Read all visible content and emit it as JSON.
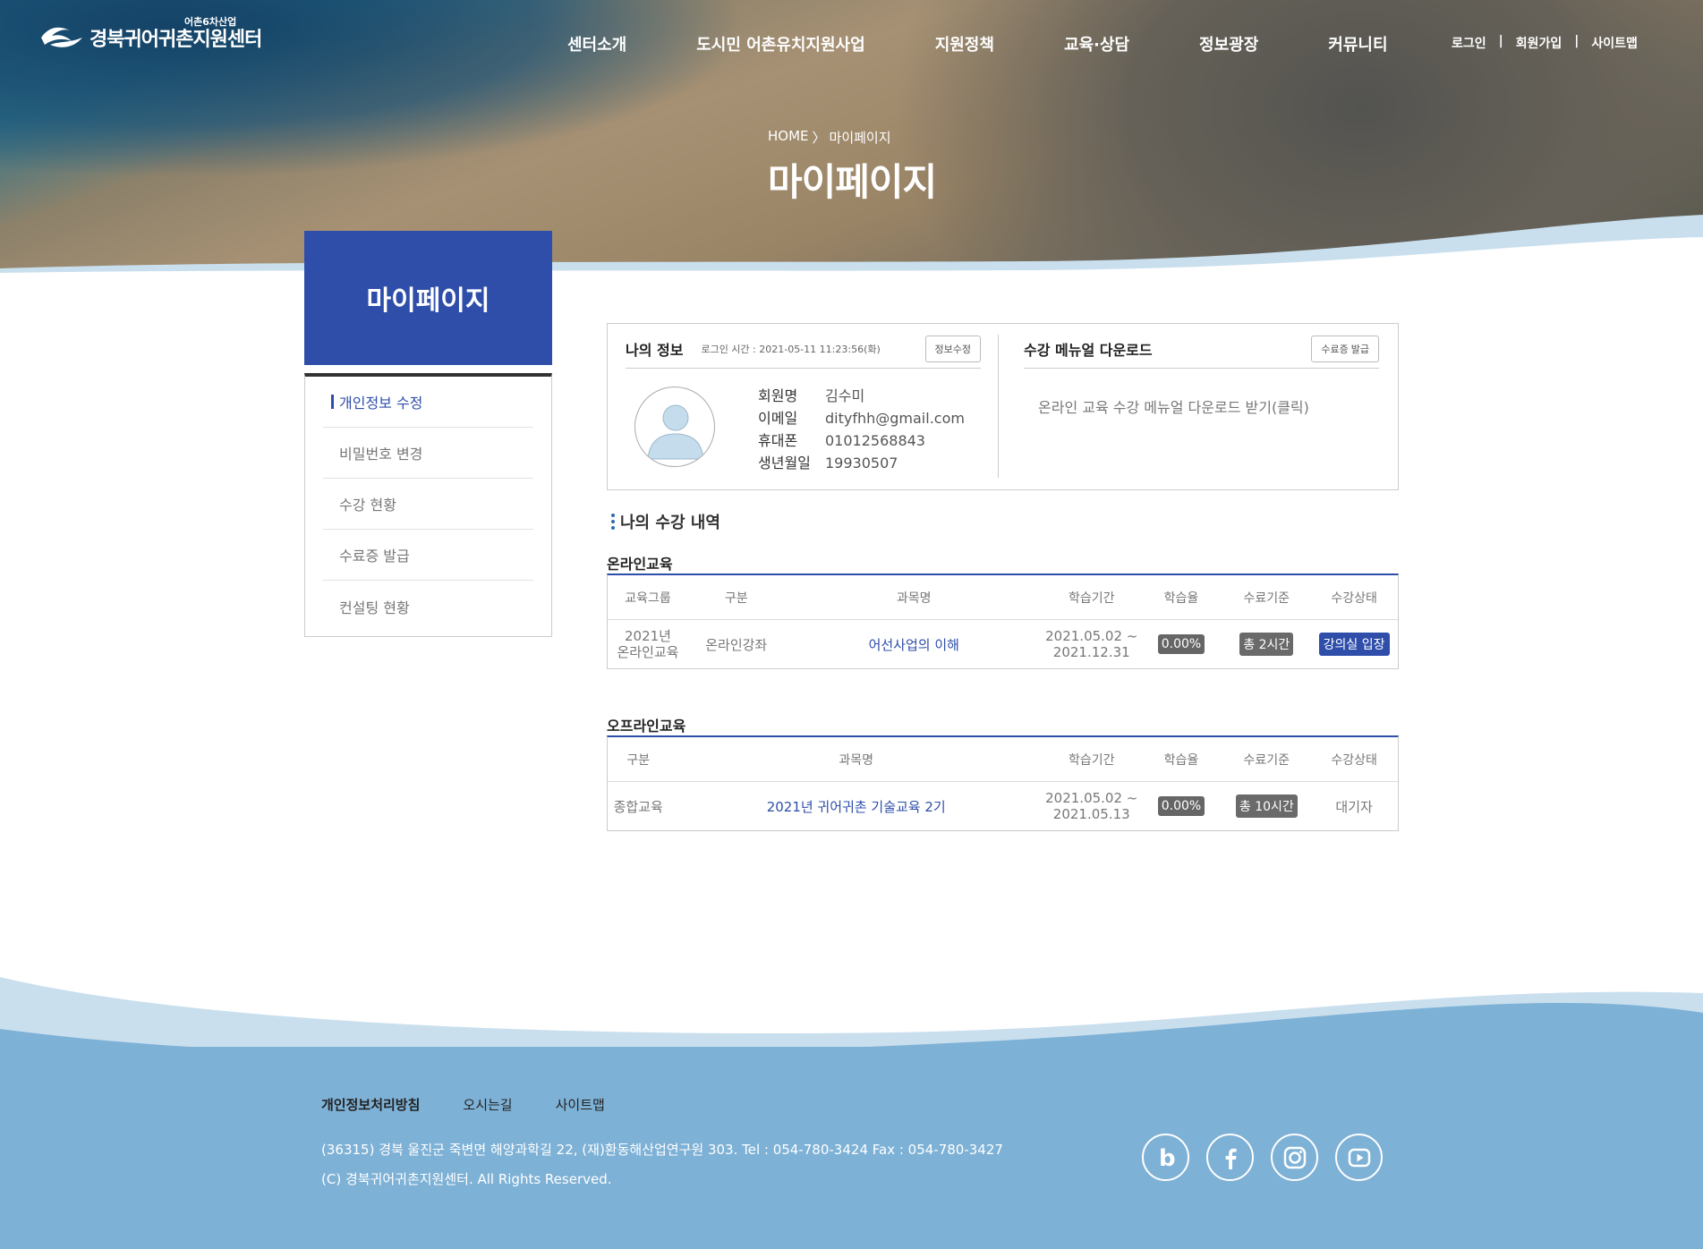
{
  "header": {
    "logo_text": "경북귀어귀촌지원센터",
    "logo_sub": "어촌6차산업",
    "nav": [
      "센터소개",
      "도시민 어촌유치지원사업",
      "지원정책",
      "교육·상담",
      "정보광장",
      "커뮤니티"
    ],
    "util": {
      "login": "로그인",
      "join": "회원가입",
      "sitemap": "사이트맵",
      "sep": "|"
    }
  },
  "hero": {
    "breadcrumb_home": "HOME",
    "breadcrumb_sep": "〉",
    "breadcrumb_current": "마이페이지",
    "title": "마이페이지"
  },
  "sidebar": {
    "title": "마이페이지",
    "items": [
      {
        "label": "개인정보 수정"
      },
      {
        "label": "비밀번호 변경"
      },
      {
        "label": "수강 현황"
      },
      {
        "label": "수료증 발급"
      },
      {
        "label": "컨설팅 현황"
      }
    ]
  },
  "my_info": {
    "title": "나의 정보",
    "login_time": "로그인 시간 : 2021-05-11 11:23:56(화)",
    "edit_button": "정보수정",
    "rows": [
      {
        "label": "회원명",
        "value": "김수미"
      },
      {
        "label": "이메일",
        "value": "dityfhh@gmail.com"
      },
      {
        "label": "휴대폰",
        "value": "01012568843"
      },
      {
        "label": "생년월일",
        "value": "19930507"
      }
    ]
  },
  "manual": {
    "title": "수강 메뉴얼 다운로드",
    "cert_button": "수료증 발급",
    "link": "온라인 교육 수강 메뉴얼 다운로드 받기(클릭)"
  },
  "history_title": "나의 수강 내역",
  "online": {
    "title": "온라인교육",
    "headers": [
      "교육그룹",
      "구분",
      "과목명",
      "학습기간",
      "학습율",
      "수료기준",
      "수강상태"
    ],
    "row": {
      "group_line1": "2021년",
      "group_line2": "온라인교육",
      "type": "온라인강좌",
      "subject": "어선사업의 이해",
      "period_line1": "2021.05.02 ~",
      "period_line2": "2021.12.31",
      "rate": "0.00%",
      "criteria": "총 2시간",
      "status": "강의실 입장"
    }
  },
  "offline": {
    "title": "오프라인교육",
    "headers": [
      "구분",
      "과목명",
      "학습기간",
      "학습율",
      "수료기준",
      "수강상태"
    ],
    "row": {
      "type": "종합교육",
      "subject": "2021년 귀어귀촌 기술교육 2기",
      "period_line1": "2021.05.02 ~",
      "period_line2": "2021.05.13",
      "rate": "0.00%",
      "criteria": "총 10시간",
      "status": "대기자"
    }
  },
  "footer": {
    "links": [
      "개인정보처리방침",
      "오시는길",
      "사이트맵"
    ],
    "address": "(36315) 경북 울진군 죽변면 해양과학길 22, (재)환동해산업연구원 303.  Tel : 054-780-3424   Fax : 054-780-3427",
    "copyright": "(C) 경북귀어귀촌지원센터. All Rights Reserved.",
    "sns": [
      "blog-icon",
      "facebook-icon",
      "instagram-icon",
      "youtube-icon"
    ]
  },
  "colors": {
    "primary": "#2e4eaa",
    "footer_bg": "#7eb1d6",
    "wave_light": "#c9dfee"
  }
}
